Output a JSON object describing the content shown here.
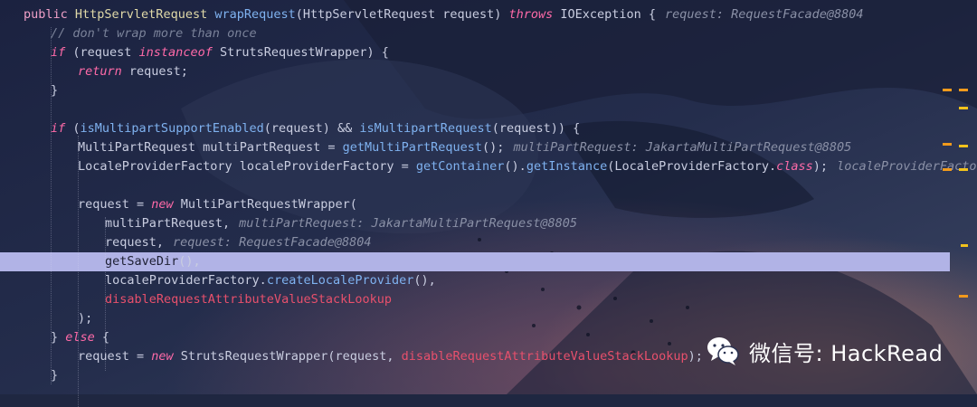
{
  "code_lines": [
    {
      "indent": 1,
      "tokens": [
        {
          "t": "public ",
          "c": "kw2"
        },
        {
          "t": "HttpServletRequest ",
          "c": "ty"
        },
        {
          "t": "wrapRequest",
          "c": "fn"
        },
        {
          "t": "(HttpServletRequest request) ",
          "c": "punc"
        },
        {
          "t": "throws ",
          "c": "kw"
        },
        {
          "t": "IOException {",
          "c": "punc"
        }
      ],
      "hint": "request: RequestFacade@8804"
    },
    {
      "indent": 2,
      "tokens": [
        {
          "t": "// don't wrap more than once",
          "c": "cm"
        }
      ]
    },
    {
      "indent": 2,
      "tokens": [
        {
          "t": "if ",
          "c": "kw"
        },
        {
          "t": "(request ",
          "c": "punc"
        },
        {
          "t": "instanceof ",
          "c": "kw"
        },
        {
          "t": "StrutsRequestWrapper) {",
          "c": "punc"
        }
      ]
    },
    {
      "indent": 3,
      "tokens": [
        {
          "t": "return ",
          "c": "kw"
        },
        {
          "t": "request;",
          "c": "punc"
        }
      ]
    },
    {
      "indent": 2,
      "tokens": [
        {
          "t": "}",
          "c": "punc"
        }
      ]
    },
    {
      "indent": 2,
      "tokens": []
    },
    {
      "indent": 2,
      "tokens": [
        {
          "t": "if ",
          "c": "kw"
        },
        {
          "t": "(",
          "c": "punc"
        },
        {
          "t": "isMultipartSupportEnabled",
          "c": "fn"
        },
        {
          "t": "(request) && ",
          "c": "punc"
        },
        {
          "t": "isMultipartRequest",
          "c": "fn"
        },
        {
          "t": "(request)) {",
          "c": "punc"
        }
      ]
    },
    {
      "indent": 3,
      "tokens": [
        {
          "t": "MultiPartRequest multiPartRequest = ",
          "c": "punc"
        },
        {
          "t": "getMultiPartRequest",
          "c": "fn"
        },
        {
          "t": "();",
          "c": "punc"
        }
      ],
      "hint": "multiPartRequest: JakartaMultiPartRequest@8805"
    },
    {
      "indent": 3,
      "tokens": [
        {
          "t": "LocaleProviderFactory localeProviderFactory = ",
          "c": "punc"
        },
        {
          "t": "getContainer",
          "c": "fn"
        },
        {
          "t": "().",
          "c": "punc"
        },
        {
          "t": "getInstance",
          "c": "fn"
        },
        {
          "t": "(LocaleProviderFactory.",
          "c": "punc"
        },
        {
          "t": "class",
          "c": "kw"
        },
        {
          "t": ");",
          "c": "punc"
        }
      ],
      "hint": "localeProviderFactory"
    },
    {
      "indent": 3,
      "tokens": []
    },
    {
      "indent": 3,
      "tokens": [
        {
          "t": "request = ",
          "c": "punc"
        },
        {
          "t": "new ",
          "c": "kw"
        },
        {
          "t": "MultiPartRequestWrapper(",
          "c": "punc"
        }
      ]
    },
    {
      "indent": 4,
      "tokens": [
        {
          "t": "multiPartRequest,",
          "c": "punc"
        }
      ],
      "hint": "multiPartRequest: JakartaMultiPartRequest@8805"
    },
    {
      "indent": 4,
      "tokens": [
        {
          "t": "request,",
          "c": "punc"
        }
      ],
      "hint": "request: RequestFacade@8804"
    },
    {
      "indent": 4,
      "tokens": [
        {
          "t": "getSaveDir",
          "c": "fn"
        },
        {
          "t": "(),",
          "c": "punc"
        }
      ],
      "highlight": true
    },
    {
      "indent": 4,
      "tokens": [
        {
          "t": "localeProviderFactory.",
          "c": "punc"
        },
        {
          "t": "createLocaleProvider",
          "c": "fn"
        },
        {
          "t": "(),",
          "c": "punc"
        }
      ]
    },
    {
      "indent": 4,
      "tokens": [
        {
          "t": "disableRequestAttributeValueStackLookup",
          "c": "red"
        }
      ]
    },
    {
      "indent": 3,
      "tokens": [
        {
          "t": ");",
          "c": "punc"
        }
      ]
    },
    {
      "indent": 2,
      "tokens": [
        {
          "t": "} ",
          "c": "punc"
        },
        {
          "t": "else ",
          "c": "kw"
        },
        {
          "t": "{",
          "c": "punc"
        }
      ]
    },
    {
      "indent": 3,
      "tokens": [
        {
          "t": "request = ",
          "c": "punc"
        },
        {
          "t": "new ",
          "c": "kw"
        },
        {
          "t": "StrutsRequestWrapper(request, ",
          "c": "punc"
        },
        {
          "t": "disableRequestAttributeValueStackLookup",
          "c": "red"
        },
        {
          "t": ");",
          "c": "punc"
        }
      ]
    },
    {
      "indent": 2,
      "tokens": [
        {
          "t": "}",
          "c": "punc"
        }
      ]
    }
  ],
  "watermark": {
    "icon": "wechat-icon",
    "text": "微信号: HackRead"
  },
  "colors": {
    "highlight": "#b1b3e6",
    "keyword": "#ff6aa8",
    "function": "#7fb2f0",
    "red_field": "#e8506c",
    "scroll_mark": "#f29a1c"
  }
}
